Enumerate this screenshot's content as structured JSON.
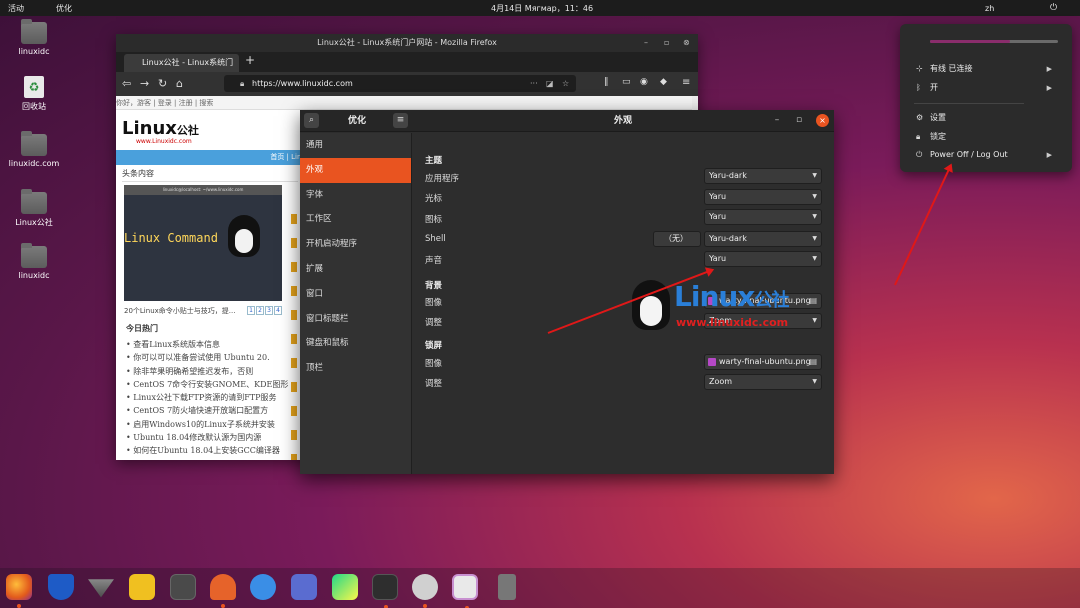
{
  "topbar": {
    "activities": "活动",
    "app_menu": "优化",
    "clock": "4月14日 Мягмар，11：46",
    "user": "zh",
    "power_icon": "power-icon"
  },
  "desktop": [
    {
      "label": "linuxidc",
      "icon": "home-folder-icon"
    },
    {
      "label": "回收站",
      "icon": "trash-icon"
    },
    {
      "label": "linuxidc.com",
      "icon": "folder-icon"
    },
    {
      "label": "Linux公社",
      "icon": "folder-icon"
    },
    {
      "label": "linuxidc",
      "icon": "folder-icon"
    }
  ],
  "firefox": {
    "window_title": "Linux公社 - Linux系统门户网站 - Mozilla Firefox",
    "tab_label": "Linux公社 - Linux系统门户",
    "url": "https://www.linuxidc.com",
    "page": {
      "top_links": "你好，游客 | 登录 | 注册 | 搜索",
      "logo_text": "Linux",
      "logo_cn": "公社",
      "logo_url": "www.Linuxidc.com",
      "breadcrumb": "首页 | Linux",
      "section": "头条内容",
      "thumb_title": "linuxidc@localhost: ~/www.linuxidc.com",
      "thumb_text": "Linux Command",
      "caption": "20个Linux命令小贴士与技巧，提...",
      "pages": [
        "1",
        "2",
        "3",
        "4"
      ],
      "hot_title": "今日热门",
      "hot_items": [
        "查看Linux系统版本信息",
        "你可以可以准备尝试使用 Ubuntu 20.",
        "除非苹果明确希望推迟发布，否则",
        "CentOS 7命令行安装GNOME、KDE图形",
        "Linux公社下载FTP资源的请到FTP服务",
        "CentOS 7防火墙快速开放端口配置方",
        "启用Windows10的Linux子系统并安装",
        "Ubuntu 18.04修改默认源为国内源",
        "如何在Ubuntu 18.04上安装GCC编译器"
      ]
    }
  },
  "tweaks": {
    "sidebar_title": "优化",
    "main_title": "外观",
    "sidebar": [
      "通用",
      "外观",
      "字体",
      "工作区",
      "开机启动程序",
      "扩展",
      "窗口",
      "窗口标题栏",
      "键盘和鼠标",
      "顶栏"
    ],
    "selected_index": 1,
    "themes_heading": "主题",
    "rows": [
      {
        "label": "应用程序",
        "value": "Yaru-dark"
      },
      {
        "label": "光标",
        "value": "Yaru"
      },
      {
        "label": "图标",
        "value": "Yaru"
      },
      {
        "label": "Shell",
        "value": "Yaru-dark",
        "none": "（无）"
      },
      {
        "label": "声音",
        "value": "Yaru"
      }
    ],
    "background_heading": "背景",
    "bg_image_label": "图像",
    "bg_image_value": "warty-final-ubuntu.png",
    "bg_adjust_label": "调整",
    "bg_adjust_value": "Zoom",
    "lock_heading": "锁屏",
    "lock_image_label": "图像",
    "lock_image_value": "warty-final-ubuntu.png",
    "lock_adjust_label": "调整",
    "lock_adjust_value": "Zoom"
  },
  "watermark": {
    "text": "Linux",
    "cn": "公社",
    "url": "www.linuxidc.com"
  },
  "system_menu": {
    "wired": "有线 已连接",
    "bluetooth": "开",
    "settings": "设置",
    "lock": "锁定",
    "power": "Power Off / Log Out"
  },
  "dock": [
    "firefox-icon",
    "shield-icon",
    "inkscape-icon",
    "rhythmbox-icon",
    "app-icon",
    "fox-icon",
    "edge-icon",
    "file-editor-icon",
    "pycharm-icon",
    "terminal-icon",
    "software-center-icon",
    "tweaks-icon",
    "usb-icon"
  ],
  "colors": {
    "accent": "#e95420",
    "topbar": "#1c1c1c",
    "arrow": "#e01818"
  }
}
